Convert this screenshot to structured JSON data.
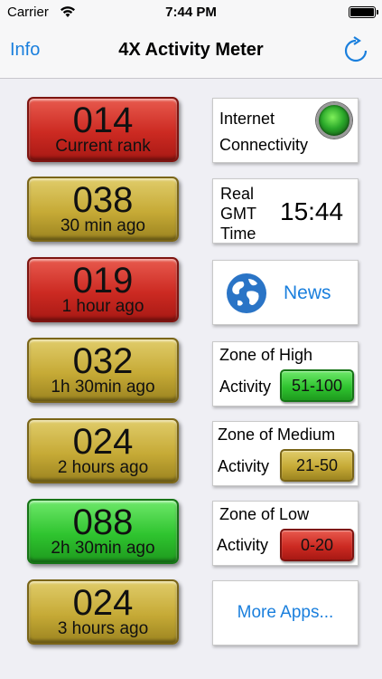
{
  "status_bar": {
    "carrier": "Carrier",
    "time": "7:44 PM"
  },
  "nav": {
    "info_label": "Info",
    "title": "4X Activity Meter",
    "refresh_icon": "refresh-icon"
  },
  "meters": [
    {
      "value": "014",
      "label": "Current rank",
      "color": "red"
    },
    {
      "value": "038",
      "label": "30 min ago",
      "color": "gold"
    },
    {
      "value": "019",
      "label": "1 hour ago",
      "color": "red"
    },
    {
      "value": "032",
      "label": "1h 30min ago",
      "color": "gold"
    },
    {
      "value": "024",
      "label": "2 hours ago",
      "color": "gold"
    },
    {
      "value": "088",
      "label": "2h 30min ago",
      "color": "green"
    },
    {
      "value": "024",
      "label": "3 hours ago",
      "color": "gold"
    }
  ],
  "connectivity": {
    "line1": "Internet",
    "line2": "Connectivity",
    "indicator_color": "#2fc42f"
  },
  "gmt": {
    "line1": "Real",
    "line2": "GMT",
    "line3": "Time",
    "time": "15:44"
  },
  "news": {
    "label": "News",
    "icon": "globe-icon"
  },
  "zones": {
    "high": {
      "line1": "Zone of High",
      "line2": "Activity",
      "range": "51-100"
    },
    "medium": {
      "line1": "Zone of Medium",
      "line2": "Activity",
      "range": "21-50"
    },
    "low": {
      "line1": "Zone of Low",
      "line2": "Activity",
      "range": "0-20"
    }
  },
  "more_apps": {
    "label": "More Apps..."
  },
  "colors": {
    "accent": "#1a7fdd",
    "red": "#cc2a22",
    "gold": "#c6aa36",
    "green": "#2fc42f"
  }
}
